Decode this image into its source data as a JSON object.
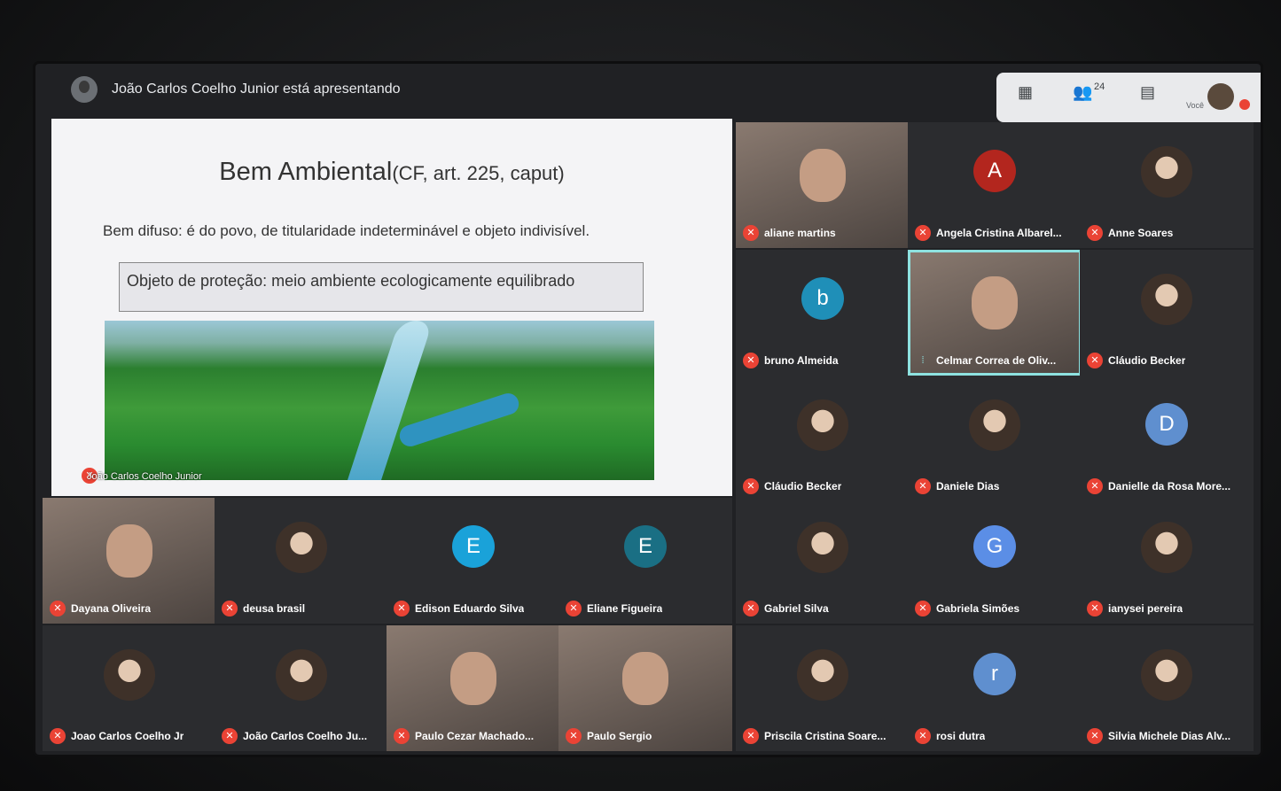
{
  "presenter": {
    "text": "João Carlos Coelho Junior está apresentando"
  },
  "controls": {
    "grid_icon": "▦",
    "people_icon": "👥",
    "people_count": "24",
    "chat_icon": "▤",
    "you_label": "Você"
  },
  "slide": {
    "title": "Bem Ambiental",
    "title_sub": "(CF, art. 225, caput)",
    "text": "Bem difuso: é do povo, de titularidade indeterminável e objeto indivisível.",
    "box": "Objeto de proteção: meio ambiente ecologicamente equilibrado",
    "caption": "João Carlos Coelho Junior"
  },
  "participants": [
    {
      "name": "aliane martins",
      "kind": "video"
    },
    {
      "name": "Angela Cristina Albarel...",
      "kind": "letter",
      "letter": "A",
      "color": "#b3261e"
    },
    {
      "name": "Anne Soares",
      "kind": "photo"
    },
    {
      "name": "bruno Almeida",
      "kind": "letter",
      "letter": "b",
      "color": "#1f8fb8"
    },
    {
      "name": "Celmar Correa de Oliv...",
      "kind": "video",
      "highlight": true
    },
    {
      "name": "Cláudio Becker",
      "kind": "photo"
    },
    {
      "name": "Cláudio Becker",
      "kind": "photo"
    },
    {
      "name": "Daniele Dias",
      "kind": "photo"
    },
    {
      "name": "Danielle da Rosa More...",
      "kind": "letter",
      "letter": "D",
      "color": "#5f8fcf"
    },
    {
      "name": "Dayana Oliveira",
      "kind": "video"
    },
    {
      "name": "deusa brasil",
      "kind": "photo"
    },
    {
      "name": "Edison Eduardo Silva",
      "kind": "letter",
      "letter": "E",
      "color": "#1aa2d9"
    },
    {
      "name": "Eliane Figueira",
      "kind": "letter",
      "letter": "E",
      "color": "#1a6f84"
    },
    {
      "name": "Gabriel Silva",
      "kind": "photo"
    },
    {
      "name": "Gabriela Simões",
      "kind": "letter",
      "letter": "G",
      "color": "#5b8ee6"
    },
    {
      "name": "ianysei pereira",
      "kind": "photo"
    },
    {
      "name": "Joao Carlos Coelho Jr",
      "kind": "photo"
    },
    {
      "name": "João Carlos Coelho Ju...",
      "kind": "photo"
    },
    {
      "name": "Paulo Cezar Machado...",
      "kind": "video"
    },
    {
      "name": "Paulo Sergio",
      "kind": "video"
    },
    {
      "name": "Priscila Cristina Soare...",
      "kind": "photo"
    },
    {
      "name": "rosi dutra",
      "kind": "letter",
      "letter": "r",
      "color": "#5f8fcf"
    },
    {
      "name": "Silvia Michele Dias Alv...",
      "kind": "photo"
    }
  ]
}
